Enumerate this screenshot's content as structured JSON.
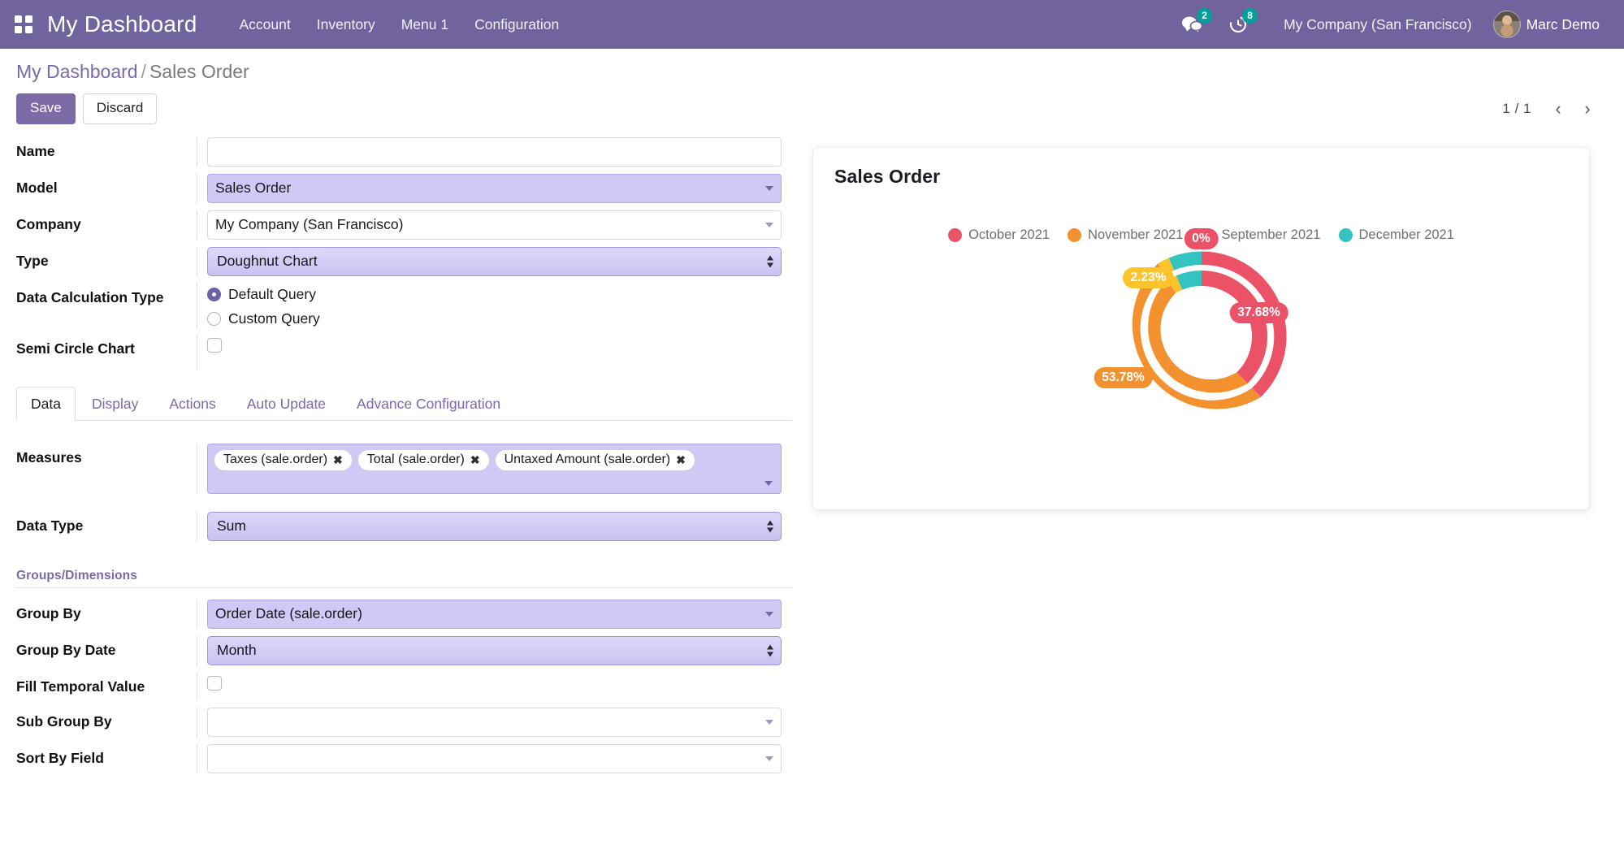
{
  "navbar": {
    "apps_icon": "apps-grid-icon",
    "brand": "My Dashboard",
    "menu": [
      {
        "label": "Account"
      },
      {
        "label": "Inventory"
      },
      {
        "label": "Menu 1"
      },
      {
        "label": "Configuration"
      }
    ],
    "messages": {
      "icon": "messages-icon",
      "count": "2"
    },
    "activities": {
      "icon": "activity-clock-icon",
      "count": "8"
    },
    "company": "My Company (San Francisco)",
    "user": "Marc Demo",
    "badge_color": "#00a09d",
    "bar_color": "#71639e"
  },
  "breadcrumb": {
    "root": "My Dashboard",
    "separator": "/",
    "current": "Sales Order"
  },
  "control_panel": {
    "save_label": "Save",
    "discard_label": "Discard",
    "pager_count": "1 / 1",
    "prev_icon": "chevron-left-icon",
    "next_icon": "chevron-right-icon"
  },
  "form": {
    "name": {
      "label": "Name",
      "value": "",
      "placeholder": ""
    },
    "model": {
      "label": "Model",
      "value": "Sales Order"
    },
    "company": {
      "label": "Company",
      "value": "My Company (San Francisco)"
    },
    "type": {
      "label": "Type",
      "value": "Doughnut Chart"
    },
    "data_calculation_type": {
      "label": "Data Calculation Type",
      "options": [
        {
          "label": "Default Query",
          "selected": true
        },
        {
          "label": "Custom Query",
          "selected": false
        }
      ]
    },
    "semi_circle_chart": {
      "label": "Semi Circle Chart",
      "checked": false
    }
  },
  "notebook": {
    "tabs": [
      {
        "label": "Data",
        "active": true
      },
      {
        "label": "Display",
        "active": false
      },
      {
        "label": "Actions",
        "active": false
      },
      {
        "label": "Auto Update",
        "active": false
      },
      {
        "label": "Advance Configuration",
        "active": false
      }
    ]
  },
  "data_tab": {
    "measures": {
      "label": "Measures",
      "tags": [
        {
          "label": "Taxes (sale.order)",
          "remove": "✖"
        },
        {
          "label": "Total (sale.order)",
          "remove": "✖"
        },
        {
          "label": "Untaxed Amount (sale.order)",
          "remove": "✖"
        }
      ]
    },
    "data_type": {
      "label": "Data Type",
      "value": "Sum"
    },
    "groups_dimensions_title": "Groups/Dimensions",
    "group_by": {
      "label": "Group By",
      "value": "Order Date (sale.order)"
    },
    "group_by_date": {
      "label": "Group By Date",
      "value": "Month"
    },
    "fill_temporal_value": {
      "label": "Fill Temporal Value",
      "checked": false
    },
    "sub_group_by": {
      "label": "Sub Group By",
      "value": ""
    },
    "sort_by_field": {
      "label": "Sort By Field",
      "value": ""
    }
  },
  "chart_card": {
    "title": "Sales Order"
  },
  "chart_data": {
    "type": "pie",
    "variant": "doughnut-nested",
    "title": "Sales Order",
    "legend_position": "top-center",
    "categories": [
      "October 2021",
      "November 2021",
      "September 2021",
      "December 2021"
    ],
    "colors": [
      "#ec5267",
      "#f3912f",
      "#fcc42c",
      "#35c3bf"
    ],
    "labels_shown": [
      "0%",
      "2.23%",
      "37.68%",
      "53.78%"
    ],
    "rings": [
      {
        "name": "outer",
        "slices": [
          {
            "category": "October 2021",
            "value": 37.68,
            "label": "37.68%",
            "color": "#ec5267"
          },
          {
            "category": "November 2021",
            "value": 53.78,
            "label": "53.78%",
            "color": "#f3912f"
          },
          {
            "category": "September 2021",
            "value": 2.23,
            "label": "2.23%",
            "color": "#fcc42c"
          },
          {
            "category": "December 2021",
            "value": 6.31,
            "label": "",
            "color": "#35c3bf"
          }
        ]
      },
      {
        "name": "inner",
        "slices": [
          {
            "category": "October 2021",
            "value": 37.68,
            "label": "0%",
            "color": "#ec5267"
          },
          {
            "category": "November 2021",
            "value": 53.78,
            "label": "",
            "color": "#f3912f"
          },
          {
            "category": "September 2021",
            "value": 2.23,
            "label": "",
            "color": "#fcc42c"
          },
          {
            "category": "December 2021",
            "value": 6.31,
            "label": "",
            "color": "#35c3bf"
          }
        ]
      }
    ],
    "unit": "%"
  }
}
